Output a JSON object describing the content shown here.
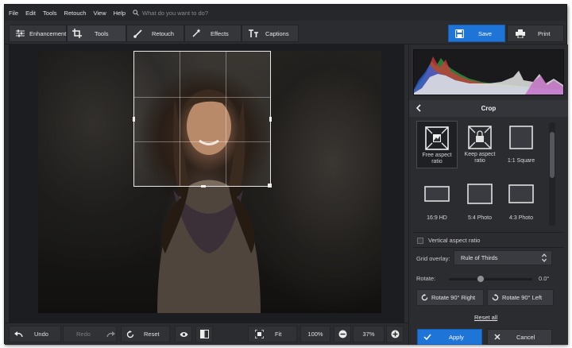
{
  "menu": {
    "items": [
      "File",
      "Edit",
      "Tools",
      "Retouch",
      "View",
      "Help"
    ],
    "search_placeholder": "What do you want to do?"
  },
  "toolbar": {
    "tabs": [
      {
        "label": "Enhancement",
        "icon": "sliders-icon"
      },
      {
        "label": "Tools",
        "icon": "crop-icon",
        "active": true
      },
      {
        "label": "Retouch",
        "icon": "brush-icon"
      },
      {
        "label": "Effects",
        "icon": "magic-wand-icon"
      },
      {
        "label": "Captions",
        "icon": "text-icon"
      }
    ],
    "save_label": "Save",
    "print_label": "Print"
  },
  "bottom": {
    "undo": "Undo",
    "redo": "Redo",
    "reset": "Reset",
    "fit": "Fit",
    "zoom_100": "100%",
    "zoom_value": "37%"
  },
  "panel": {
    "title": "Crop",
    "presets": [
      {
        "label": "Free aspect ratio",
        "selected": true
      },
      {
        "label": "Keep aspect ratio"
      },
      {
        "label": "1:1 Square"
      },
      {
        "label": "16:9 HD"
      },
      {
        "label": "5:4 Photo"
      },
      {
        "label": "4:3 Photo"
      }
    ],
    "vertical_aspect_label": "Vertical aspect ratio",
    "grid_overlay_label": "Grid overlay:",
    "grid_overlay_value": "Rule of Thirds",
    "rotate_label": "Rotate:",
    "rotate_value": "0.0°",
    "rotate_right": "Rotate 90° Right",
    "rotate_left": "Rotate 90° Left",
    "reset_all": "Reset all",
    "apply": "Apply",
    "cancel": "Cancel"
  },
  "colors": {
    "accent": "#1f74d8",
    "background": "#2b2c30"
  }
}
